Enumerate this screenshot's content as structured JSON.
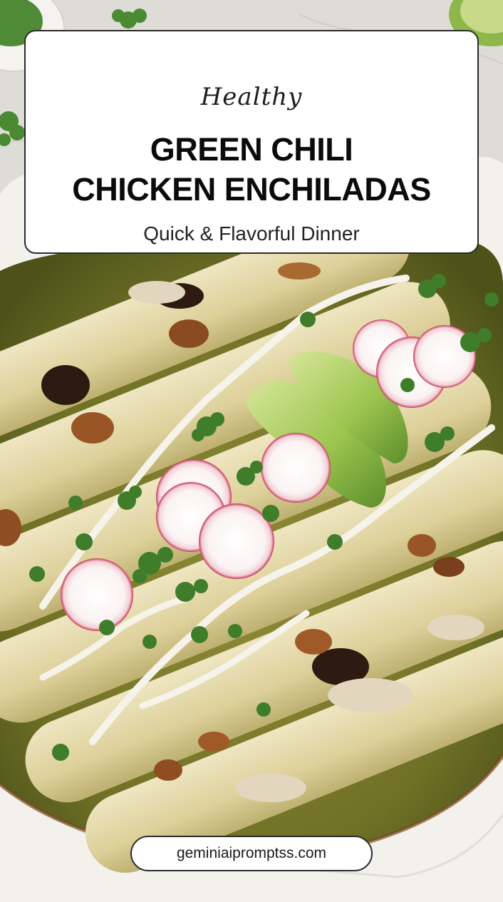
{
  "card": {
    "kicker": "Healthy",
    "headline_line1": "GREEN CHILI",
    "headline_line2": "CHICKEN ENCHILADAS",
    "subtitle": "Quick & Flavorful Dinner"
  },
  "footer": {
    "url": "geminiaipromptss.com"
  },
  "colors": {
    "sauce": "#7a7d2c",
    "cheese": "#e6ddb5",
    "char": "#3d2414",
    "cream": "#f5f1e6",
    "avocado": "#8fbf45",
    "radish_rim": "#c7385a",
    "cilantro": "#3f7d2a",
    "dish": "#f3f1ec"
  }
}
